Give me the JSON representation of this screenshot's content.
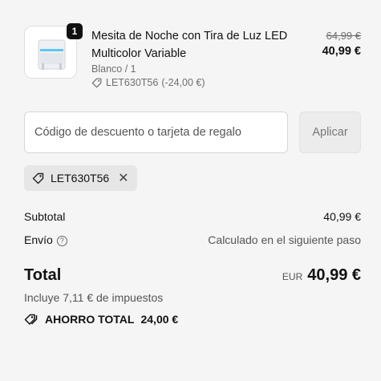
{
  "cart_item": {
    "quantity": "1",
    "title": "Mesita de Noche con Tira de Luz LED Multicolor Variable",
    "variant": "Blanco / 1",
    "discount_code": "LET630T56",
    "discount_amount": "(-24,00 €)",
    "original_price": "64,99 €",
    "price": "40,99 €",
    "thumbnail_icon": "bedside-table-image"
  },
  "discount_form": {
    "placeholder": "Código de descuento o tarjeta de regalo",
    "apply_label": "Aplicar"
  },
  "applied_code": {
    "code": "LET630T56",
    "icon": "tag-icon",
    "remove_icon": "close-icon",
    "remove_glyph": "✕"
  },
  "summary": {
    "subtotal_label": "Subtotal",
    "subtotal_value": "40,99 €",
    "shipping_label": "Envío",
    "shipping_value": "Calculado en el siguiente paso",
    "help_glyph": "?",
    "total_label": "Total",
    "currency": "EUR",
    "total_value": "40,99 €",
    "tax_note": "Incluye 7,11 € de impuestos",
    "savings_label": "AHORRO TOTAL",
    "savings_value": "24,00 €"
  },
  "colors": {
    "background": "#f5f5f5",
    "text": "#111111",
    "muted": "#6f6f6f",
    "badge": "#111111",
    "chip": "#e6e6e6"
  }
}
